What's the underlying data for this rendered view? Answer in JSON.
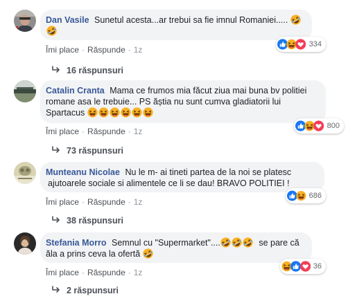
{
  "comments": [
    {
      "author": "Dan Vasile",
      "text": "Sunetul acesta...ar trebui sa fie imnul Romaniei.....",
      "reaction_count": "334",
      "like": "Îmi place",
      "reply": "Răspunde",
      "time": "1z",
      "replies_label": "16 răspunsuri",
      "reaction_icons": [
        "like-icon",
        "haha-icon",
        "love-icon"
      ]
    },
    {
      "author": "Catalin Cranta",
      "text_line1": "Mama ce frumos mia făcut ziua mai buna bv politiei",
      "text_line2": "romane asa le trebuie... PS ăștia nu sunt cumva gladiatorii lui",
      "text_line3": "Spartacus",
      "reaction_count": "800",
      "like": "Îmi place",
      "reply": "Răspunde",
      "time": "1z",
      "replies_label": "73 răspunsuri",
      "reaction_icons": [
        "like-icon",
        "haha-icon",
        "love-icon"
      ]
    },
    {
      "author": "Munteanu Nicolae",
      "text_line1": "Nu le m- ai tineti partea de la noi se platesc",
      "text_line2": "ajutoarele sociale si alimentele ce li se dau! BRAVO POLITIEI !",
      "reaction_count": "686",
      "like": "Îmi place",
      "reply": "Răspunde",
      "time": "1z",
      "replies_label": "38 răspunsuri",
      "reaction_icons": [
        "like-icon",
        "haha-icon"
      ]
    },
    {
      "author": "Stefania Morro",
      "text_part1": "Semnul cu \"Supermarket\"....",
      "text_part2": "se pare că",
      "text_line2": "ăla a prins ceva la ofertă",
      "reaction_count": "36",
      "like": "Îmi place",
      "reply": "Răspunde",
      "time": "1z",
      "replies_label": "2 răspunsuri",
      "reaction_icons": [
        "haha-icon",
        "like-icon",
        "love-icon"
      ]
    }
  ],
  "colors": {
    "author": "#385898",
    "bubble": "#f2f3f5",
    "like": "#1877f2",
    "love": "#f33e58",
    "haha": "#f7b125"
  }
}
